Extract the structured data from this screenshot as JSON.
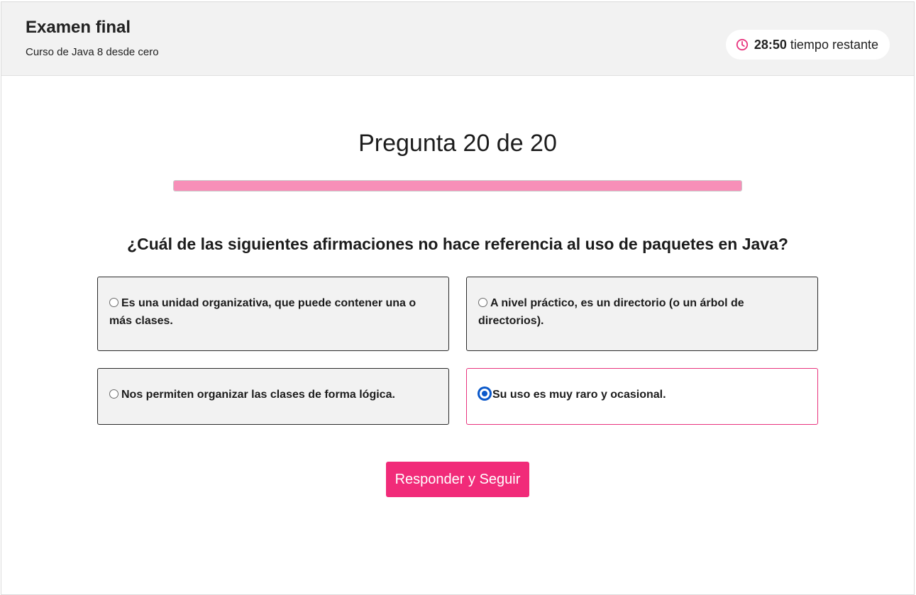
{
  "header": {
    "title": "Examen final",
    "course": "Curso de Java 8 desde cero",
    "timer": {
      "time": "28:50",
      "label": "tiempo restante",
      "icon": "clock-icon",
      "icon_color": "#e8347e"
    }
  },
  "quiz": {
    "counter": "Pregunta 20 de 20",
    "progress_fraction": 1.0,
    "progress_color": "#f78fb8",
    "question": "¿Cuál de las siguientes afirmaciones no hace referencia al uso de paquetes en Java?",
    "options": [
      {
        "label": "Es una unidad organizativa, que puede contener una o más clases.",
        "selected": false
      },
      {
        "label": "A nivel práctico, es un directorio (o un árbol de directorios).",
        "selected": false
      },
      {
        "label": "Nos permiten organizar las clases de forma lógica.",
        "selected": false
      },
      {
        "label": "Su uso es muy raro y ocasional.",
        "selected": true
      }
    ],
    "submit_label": "Responder y Seguir",
    "accent_color": "#f12b79"
  }
}
